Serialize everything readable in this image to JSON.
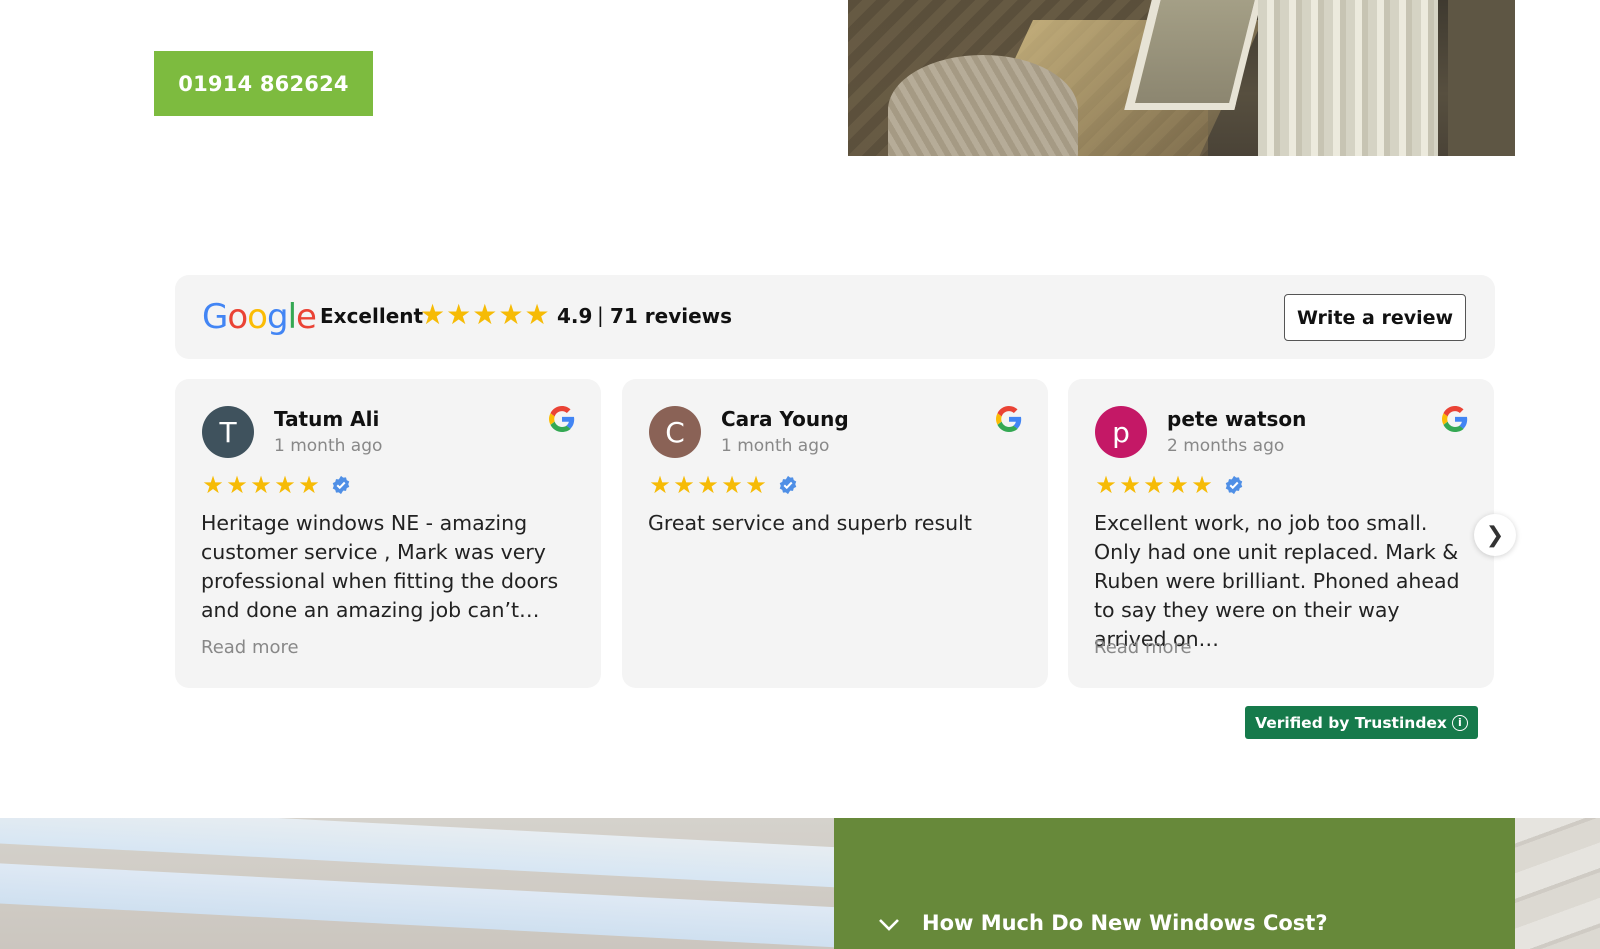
{
  "cta": {
    "phone": "01914 862624"
  },
  "rating_bar": {
    "logo": {
      "g1": "G",
      "o1": "o",
      "o2": "o",
      "g2": "g",
      "l": "l",
      "e": "e"
    },
    "label": "Excellent",
    "stars": 5,
    "score": "4.9",
    "separator": "|",
    "count": "71 reviews",
    "write_review": "Write a review"
  },
  "reviews": [
    {
      "initial": "T",
      "name": "Tatum Ali",
      "date": "1 month ago",
      "stars": 5,
      "text": "Heritage windows NE - amazing customer service , Mark was very professional when fitting the doors and done an amazing job can’t…",
      "read_more": "Read more",
      "avatar_color": "#3f525d"
    },
    {
      "initial": "C",
      "name": "Cara Young",
      "date": "1 month ago",
      "stars": 5,
      "text": "Great service and superb result",
      "avatar_color": "#8a6256"
    },
    {
      "initial": "p",
      "name": "pete watson",
      "date": "2 months ago",
      "stars": 5,
      "text": "Excellent work, no job too small. Only had one unit replaced. Mark & Ruben were brilliant. Phoned ahead to say they were on their way arrived on…",
      "read_more": "Read more",
      "avatar_color": "#c41866"
    }
  ],
  "verified_badge": {
    "label": "Verified by Trustindex",
    "info": "i"
  },
  "faq": {
    "question": "How Much Do New Windows Cost?"
  },
  "icons": {
    "star": "★",
    "next": "❯"
  },
  "colors": {
    "cta_green": "#7dbb3f",
    "faq_green": "#67893a",
    "badge_green": "#167a4b",
    "star_yellow": "#f6bb06",
    "verified_blue": "#4f8fe6"
  }
}
